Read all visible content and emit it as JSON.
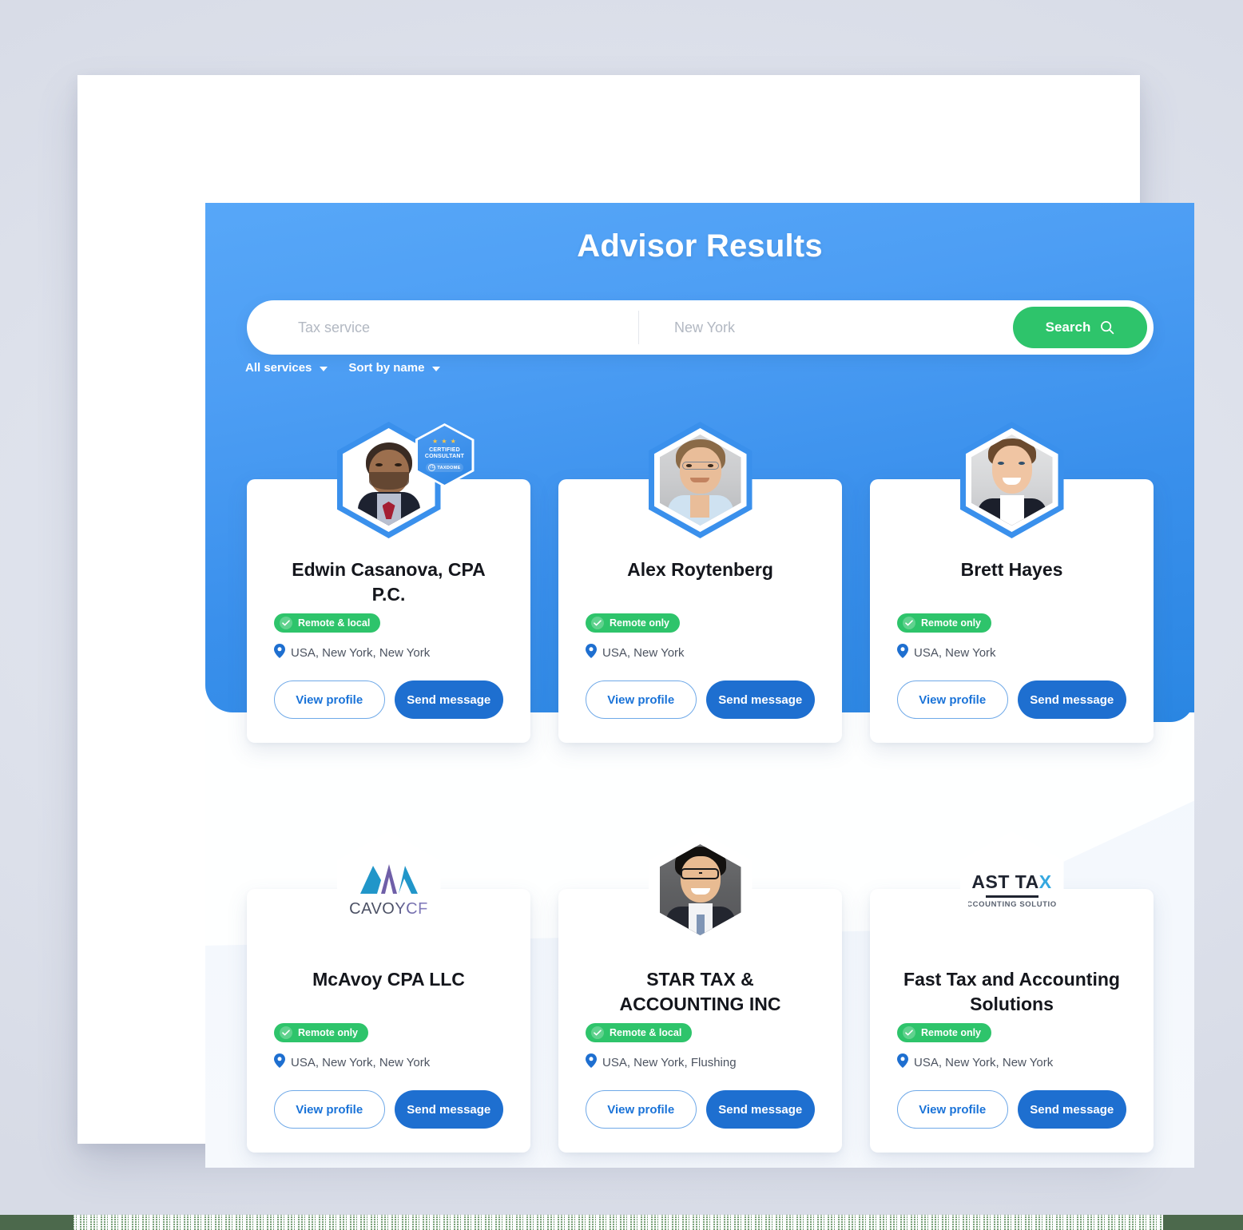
{
  "header": {
    "title": "Advisor Results"
  },
  "search": {
    "service_placeholder": "Tax service",
    "service_value": "",
    "location_placeholder": "New York",
    "location_value": "",
    "search_label": "Search",
    "search_icon": "magnifier-icon"
  },
  "filters": [
    {
      "label": "All services",
      "icon": "chevron-down-icon"
    },
    {
      "label": "Sort by name",
      "icon": "chevron-down-icon"
    }
  ],
  "buttons": {
    "view_profile": "View profile",
    "send_message": "Send message"
  },
  "certified_badge": {
    "stars": "★ ★ ★",
    "line1": "CERTIFIED",
    "line2": "CONSULTANT",
    "brand_mark": "TD",
    "brand": "TAXDOME"
  },
  "logos": {
    "cavoy": {
      "wordmark": "CAVOYCF",
      "icon": "mountain-peaks-icon"
    },
    "fasttax": {
      "line1_a": "AST TA",
      "line1_b": "",
      "line2": "CCOUNTING SOLUTIO"
    }
  },
  "cards": [
    {
      "name": "Edwin Casanova, CPA P.C.",
      "availability": "Remote & local",
      "location": "USA, New York, New York",
      "avatar": "photo-portrait-1",
      "certified": true
    },
    {
      "name": "Alex Roytenberg",
      "availability": "Remote only",
      "location": "USA, New York",
      "avatar": "photo-portrait-2",
      "certified": false
    },
    {
      "name": "Brett Hayes",
      "availability": "Remote only",
      "location": "USA, New York",
      "avatar": "photo-portrait-3",
      "certified": false
    },
    {
      "name": "McAvoy CPA LLC",
      "availability": "Remote only",
      "location": "USA, New York, New York",
      "avatar": "logo-cavoycf",
      "certified": false
    },
    {
      "name": "STAR TAX & ACCOUNTING INC",
      "availability": "Remote & local",
      "location": "USA, New York, Flushing",
      "avatar": "photo-portrait-4",
      "certified": false
    },
    {
      "name": "Fast Tax and Accounting Solutions",
      "availability": "Remote only",
      "location": "USA, New York, New York",
      "avatar": "logo-fasttax",
      "certified": false
    }
  ],
  "colors": {
    "hero_blue_top": "#57a7f8",
    "hero_blue_bottom": "#2a86e2",
    "accent_green": "#2ec46b",
    "primary_blue": "#1e6fd0",
    "page_bg": "#e3e6ee"
  }
}
